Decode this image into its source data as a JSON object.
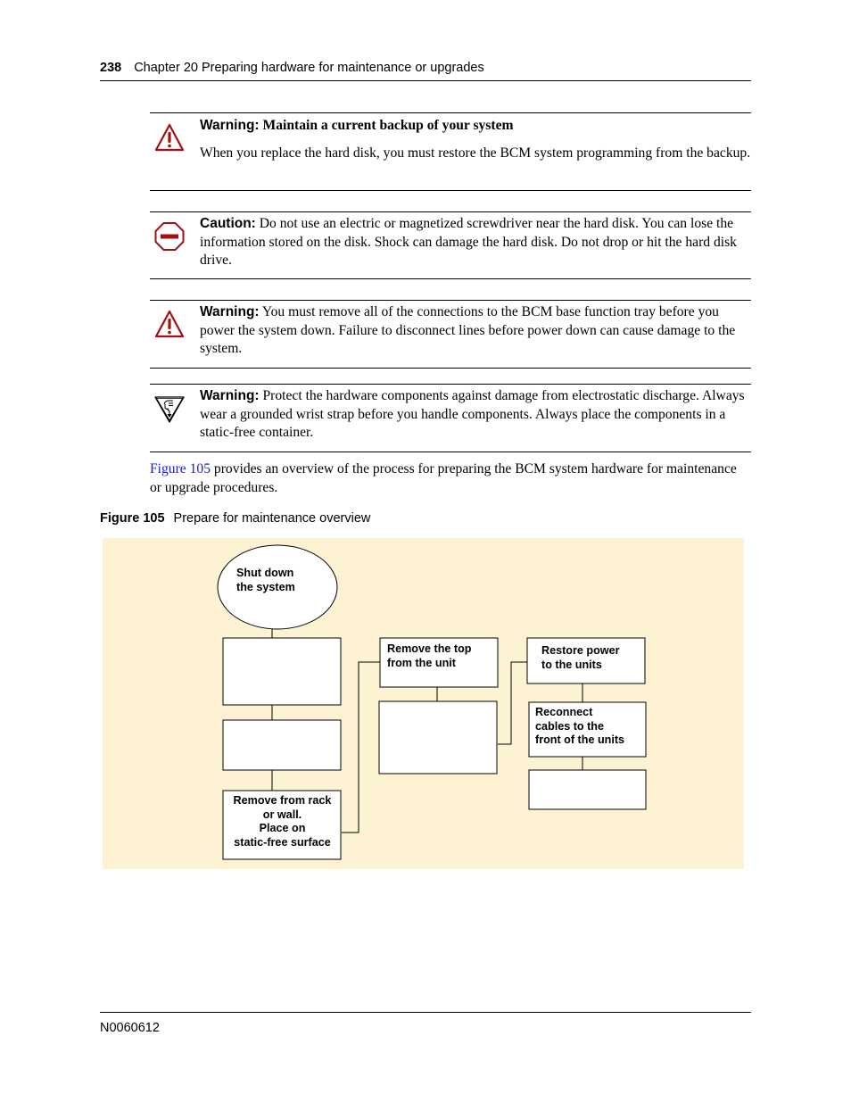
{
  "header": {
    "page_number": "238",
    "chapter": "Chapter 20  Preparing hardware for maintenance or upgrades"
  },
  "notices": [
    {
      "type": "warning",
      "icon": "warning-triangle-icon",
      "label": "Warning:",
      "title": "Maintain a current backup of your system",
      "body": "When you replace the hard disk, you must restore the BCM system programming from the backup."
    },
    {
      "type": "caution",
      "icon": "stop-sign-icon",
      "label": "Caution:",
      "body": "Do not use an electric or magnetized screwdriver near the hard disk. You can lose the information stored on the disk. Shock can damage the hard disk. Do not drop or hit the hard disk drive."
    },
    {
      "type": "warning",
      "icon": "warning-triangle-icon",
      "label": "Warning:",
      "body": "You must remove all of the connections to the BCM base function tray before you power the system down. Failure to disconnect lines before power down can cause damage to the system."
    },
    {
      "type": "esd-warning",
      "icon": "esd-hand-icon",
      "label": "Warning:",
      "body": "Protect the hardware components against damage from electrostatic discharge. Always wear a grounded wrist strap before you handle components. Always place the components in a static-free container."
    }
  ],
  "intro": {
    "link_text": "Figure 105",
    "text": " provides an overview of the process for preparing the BCM system hardware for maintenance or upgrade procedures."
  },
  "figure": {
    "number": "Figure 105",
    "caption": "Prepare for maintenance overview",
    "colors": {
      "background": "#fdf3d2",
      "box_fill": "#ffffff",
      "stroke": "#000000"
    },
    "nodes": {
      "shut_down": "Shut down\nthe system",
      "step_blank_1": "",
      "step_blank_2": "",
      "remove_from_rack": "Remove from rack\nor wall.\nPlace on\nstatic-free surface",
      "remove_top": "Remove the top\nfrom the unit",
      "step_blank_3": "",
      "restore_power": "Restore power\nto the units",
      "reconnect_cables": "Reconnect\ncables to the\nfront of the units",
      "step_blank_4": ""
    }
  },
  "footer": {
    "doc_id": "N0060612"
  }
}
